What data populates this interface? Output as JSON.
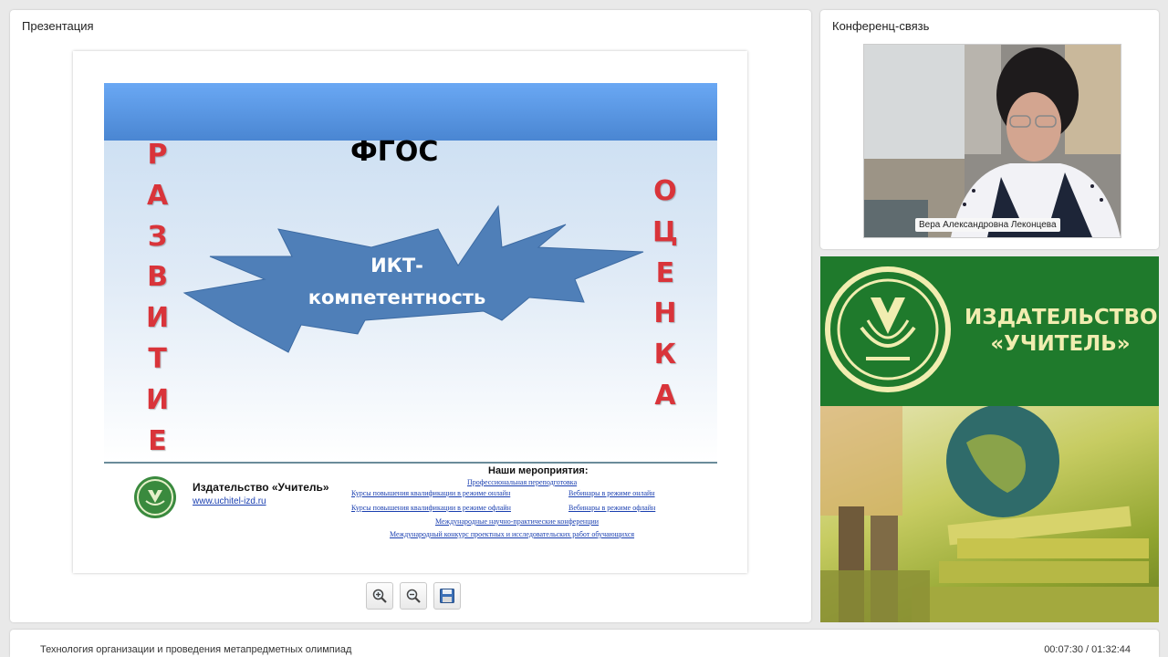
{
  "presentation": {
    "title": "Презентация",
    "slide": {
      "heading": "ФГОС",
      "left_word": [
        "Р",
        "А",
        "З",
        "В",
        "И",
        "Т",
        "И",
        "Е"
      ],
      "right_word": [
        "О",
        "Ц",
        "Е",
        "Н",
        "К",
        "А"
      ],
      "burst_text": "ИКТ-\nкомпетентность",
      "publisher_name": "Издательство «Учитель»",
      "publisher_url": "www.uchitel-izd.ru",
      "events_title": "Наши мероприятия:",
      "events": [
        "Профессиональная переподготовка",
        "Курсы повышения квалификации в режиме онлайн",
        "Вебинары в режиме онлайн",
        "Курсы повышения квалификации в режиме офлайн",
        "Вебинары в режиме офлайн",
        "Международные научно-практические конференции",
        "Международный конкурс проектных и исследовательских работ обучающихся"
      ]
    },
    "toolbar": {
      "zoom_in_icon": "zoom-in-icon",
      "zoom_out_icon": "zoom-out-icon",
      "save_icon": "floppy-disk-icon"
    }
  },
  "conference": {
    "title": "Конференц-связь",
    "participant_name": "Вера Александровна Леконцева"
  },
  "banner": {
    "text": "ИЗДАТЕЛЬСТВО\n«УЧИТЕЛЬ»"
  },
  "footer": {
    "title": "Технология организации и проведения метапредметных олимпиад",
    "time": "00:07:30 / 01:32:44"
  },
  "colors": {
    "accent_red": "#d9343a",
    "burst_blue": "#4f7fb8",
    "banner_green": "#1f7a2c"
  }
}
